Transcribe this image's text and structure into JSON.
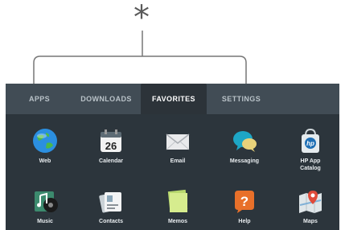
{
  "callout": {
    "symbol": "*"
  },
  "tabs": [
    {
      "label": "APPS",
      "active": false
    },
    {
      "label": "DOWNLOADS",
      "active": false
    },
    {
      "label": "FAVORITES",
      "active": true
    },
    {
      "label": "SETTINGS",
      "active": false
    }
  ],
  "apps": [
    {
      "label": "Web",
      "icon": "globe-icon"
    },
    {
      "label": "Calendar",
      "icon": "calendar-icon",
      "badge": "26"
    },
    {
      "label": "Email",
      "icon": "envelope-icon"
    },
    {
      "label": "Messaging",
      "icon": "chat-bubble-icon"
    },
    {
      "label": "HP App\nCatalog",
      "icon": "hp-bag-icon",
      "badge": "hp"
    },
    {
      "label": "Music",
      "icon": "music-icon"
    },
    {
      "label": "Contacts",
      "icon": "contacts-icon"
    },
    {
      "label": "Memos",
      "icon": "memo-icon"
    },
    {
      "label": "Help",
      "icon": "help-icon",
      "badge": "?"
    },
    {
      "label": "Maps",
      "icon": "map-pin-icon"
    }
  ],
  "colors": {
    "tabbar": "#414c55",
    "active_tab": "#2c3339",
    "grid_bg": "#2c353c",
    "callout": "#5a5a5a"
  }
}
